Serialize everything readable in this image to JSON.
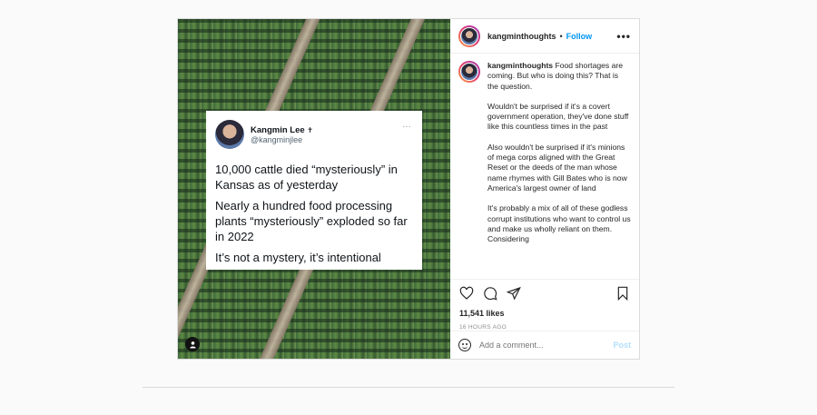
{
  "post": {
    "username": "kangminthoughts",
    "follow_label": "Follow",
    "dot": "•",
    "more": "•••",
    "likes": "11,541 likes",
    "time_ago": "16 HOURS AGO",
    "comment_placeholder": "Add a comment...",
    "post_label": "Post"
  },
  "tweet": {
    "name": "Kangmin Lee",
    "badge": "✝",
    "handle": "@kangminjlee",
    "more": "···",
    "lines": [
      "10,000 cattle died “mysteriously” in Kansas as of yesterday",
      "Nearly a hundred food processing plants “mysteriously” exploded so far in 2022",
      "It’s not a mystery, it’s intentional"
    ]
  },
  "caption": {
    "username": "kangminthoughts",
    "paragraphs": [
      "Food shortages are coming. But who is doing this? That is the question.",
      "Wouldn't be surprised if it's a covert government operation, they've done stuff like this countless times in the past",
      "Also wouldn't be surprised if it's minions of mega corps aligned with the Great Reset or the deeds of the man whose name rhymes with Gill Bates who is now America's largest owner of land",
      "It's probably a mix of all of these godless corrupt institutions who want to control us and make us wholly reliant on them. Considering"
    ]
  },
  "icons": [
    "heart-icon",
    "comment-icon",
    "share-icon",
    "bookmark-icon",
    "emoji-icon",
    "more-icon",
    "user-tag-icon"
  ],
  "colors": {
    "follow": "#0095f6",
    "post_disabled": "#b2dffc",
    "border": "#dbdbdb"
  }
}
